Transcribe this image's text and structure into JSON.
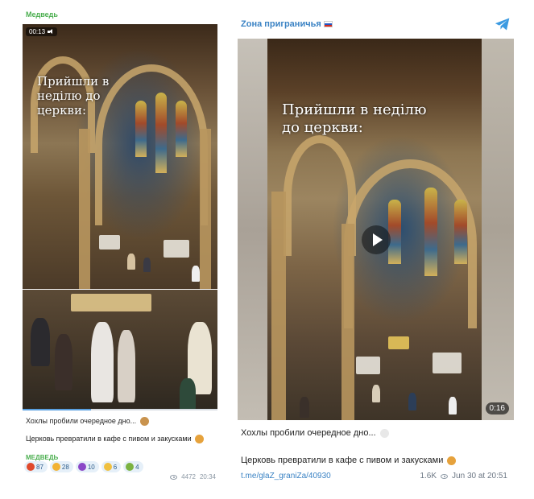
{
  "left_post": {
    "channel": "Медведь",
    "video_time": "00:13",
    "overlay_text": "Прийшли в неділю до церкви:",
    "caption_line1": "Хохлы пробили очередное дно...",
    "caption_line2": "Церковь превратили в кафе с пивом и закусками",
    "author": "МЕДВЕДЬ",
    "progress_fraction": 0.35,
    "reactions": [
      {
        "icon": "angry-face-icon",
        "color": "#e0492b",
        "count": "87"
      },
      {
        "icon": "laughing-face-icon",
        "color": "#f2b233",
        "count": "28"
      },
      {
        "icon": "devil-face-icon",
        "color": "#8a47c7",
        "count": "10"
      },
      {
        "icon": "scared-face-icon",
        "color": "#f0c040",
        "count": "6"
      },
      {
        "icon": "vomit-face-icon",
        "color": "#7cb342",
        "count": "4"
      }
    ],
    "views": "4472",
    "time": "20:34"
  },
  "right_post": {
    "channel": "Zона приграничья",
    "overlay_text": "Прийшли в неділю до церкви:",
    "duration": "0:16",
    "caption_line1": "Хохлы пробили очередное дно...",
    "caption_line2": "Церковь превратили в кафе с пивом и закусками",
    "link": "t.me/glaZ_graniZa/40930",
    "views": "1.6K",
    "date": "Jun 30 at 20:51"
  },
  "colors": {
    "channel_green": "#4caf50",
    "telegram_blue": "#3b83c4"
  }
}
